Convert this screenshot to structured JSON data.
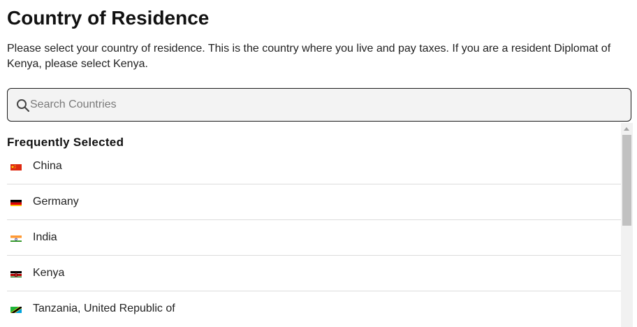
{
  "page": {
    "title": "Country of Residence",
    "description": "Please select your country of residence. This is the country where you live and pay taxes. If you are a resident Diplomat of Kenya, please select Kenya."
  },
  "search": {
    "placeholder": "Search Countries",
    "value": "",
    "icon": "search-icon"
  },
  "frequent": {
    "heading": "Frequently Selected",
    "countries": [
      {
        "name": "China",
        "flag": "china-flag-icon",
        "colors": [
          "#de2910",
          "#ffde00"
        ]
      },
      {
        "name": "Germany",
        "flag": "germany-flag-icon",
        "colors": [
          "#000000",
          "#dd0000",
          "#ffce00"
        ]
      },
      {
        "name": "India",
        "flag": "india-flag-icon",
        "colors": [
          "#ff9933",
          "#ffffff",
          "#138808",
          "#000080"
        ]
      },
      {
        "name": "Kenya",
        "flag": "kenya-flag-icon",
        "colors": [
          "#000000",
          "#bb0000",
          "#006600",
          "#ffffff"
        ]
      },
      {
        "name": "Tanzania, United Republic of",
        "flag": "tanzania-flag-icon",
        "colors": [
          "#1eb53a",
          "#00a3dd",
          "#fcd116",
          "#000000"
        ]
      }
    ]
  },
  "scrollbar": {
    "position": 0.0
  }
}
